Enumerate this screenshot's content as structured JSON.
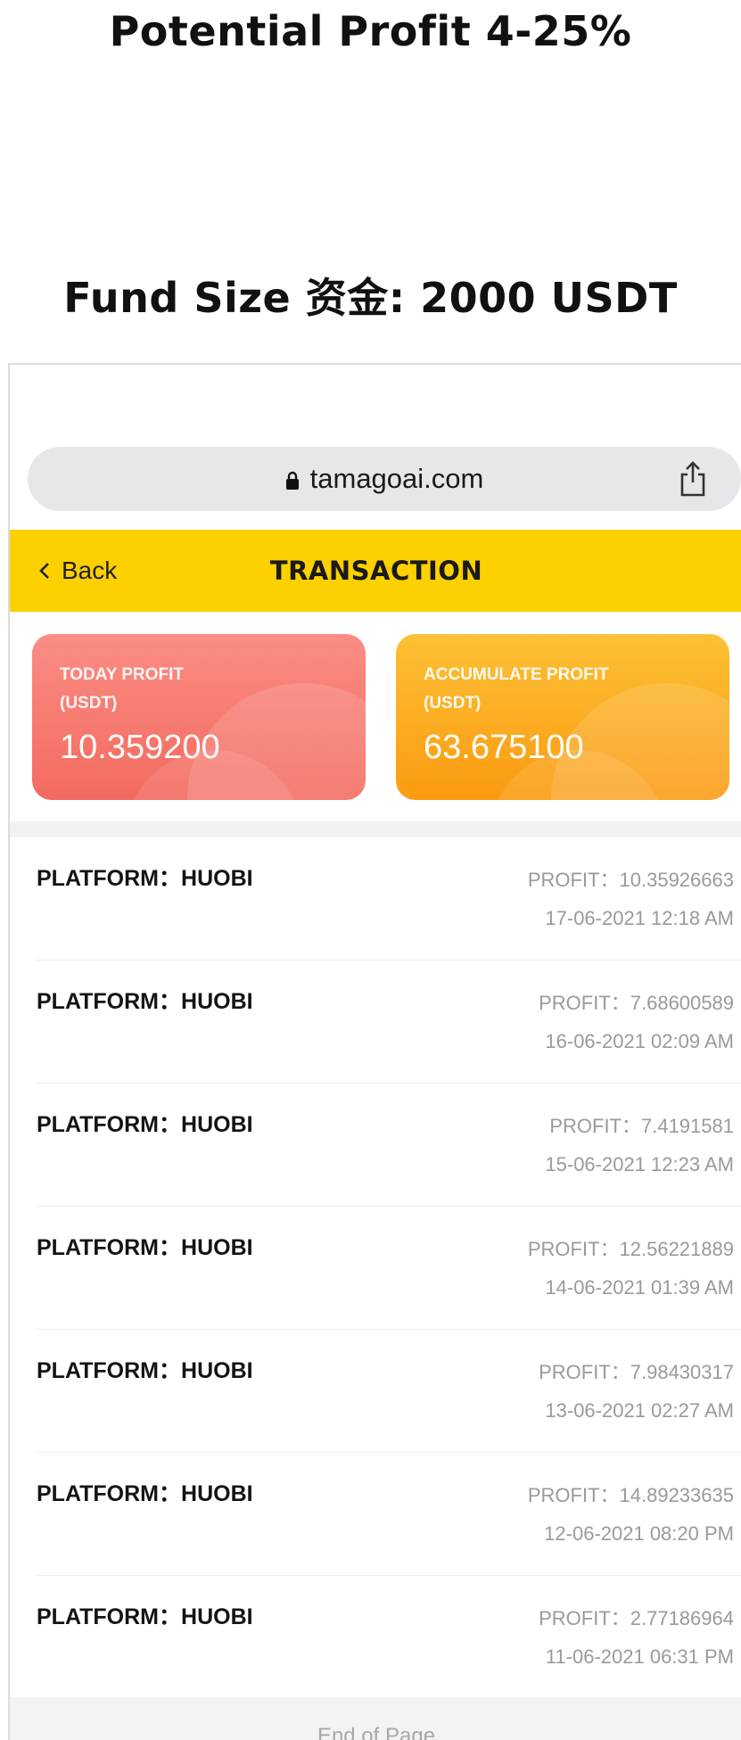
{
  "headline": {
    "profit_range": "Potential Profit 4-25%",
    "fund_size": "Fund Size 资金: 2000 USDT"
  },
  "browser": {
    "url": "tamagoai.com",
    "icons": [
      "lock-icon",
      "share-icon"
    ]
  },
  "navbar": {
    "back_label": "Back",
    "title": "TRANSACTION",
    "color": "#fdd000"
  },
  "summary": {
    "today": {
      "label_line1": "TODAY PROFIT",
      "label_line2": "(USDT)",
      "value": "10.359200",
      "color": "#f36a5f"
    },
    "accumulate": {
      "label_line1": "ACCUMULATE PROFIT",
      "label_line2": "(USDT)",
      "value": "63.675100",
      "color": "#fb9a10"
    }
  },
  "transactions": [
    {
      "platform": "PLATFORM：HUOBI",
      "profit": "PROFIT：10.35926663",
      "time": "17-06-2021 12:18 AM"
    },
    {
      "platform": "PLATFORM：HUOBI",
      "profit": "PROFIT：7.68600589",
      "time": "16-06-2021 02:09 AM"
    },
    {
      "platform": "PLATFORM：HUOBI",
      "profit": "PROFIT：7.4191581",
      "time": "15-06-2021 12:23 AM"
    },
    {
      "platform": "PLATFORM：HUOBI",
      "profit": "PROFIT：12.56221889",
      "time": "14-06-2021 01:39 AM"
    },
    {
      "platform": "PLATFORM：HUOBI",
      "profit": "PROFIT：7.98430317",
      "time": "13-06-2021 02:27 AM"
    },
    {
      "platform": "PLATFORM：HUOBI",
      "profit": "PROFIT：14.89233635",
      "time": "12-06-2021 08:20 PM"
    },
    {
      "platform": "PLATFORM：HUOBI",
      "profit": "PROFIT：2.77186964",
      "time": "11-06-2021 06:31 PM"
    }
  ],
  "footer": {
    "text": "End of Page"
  }
}
